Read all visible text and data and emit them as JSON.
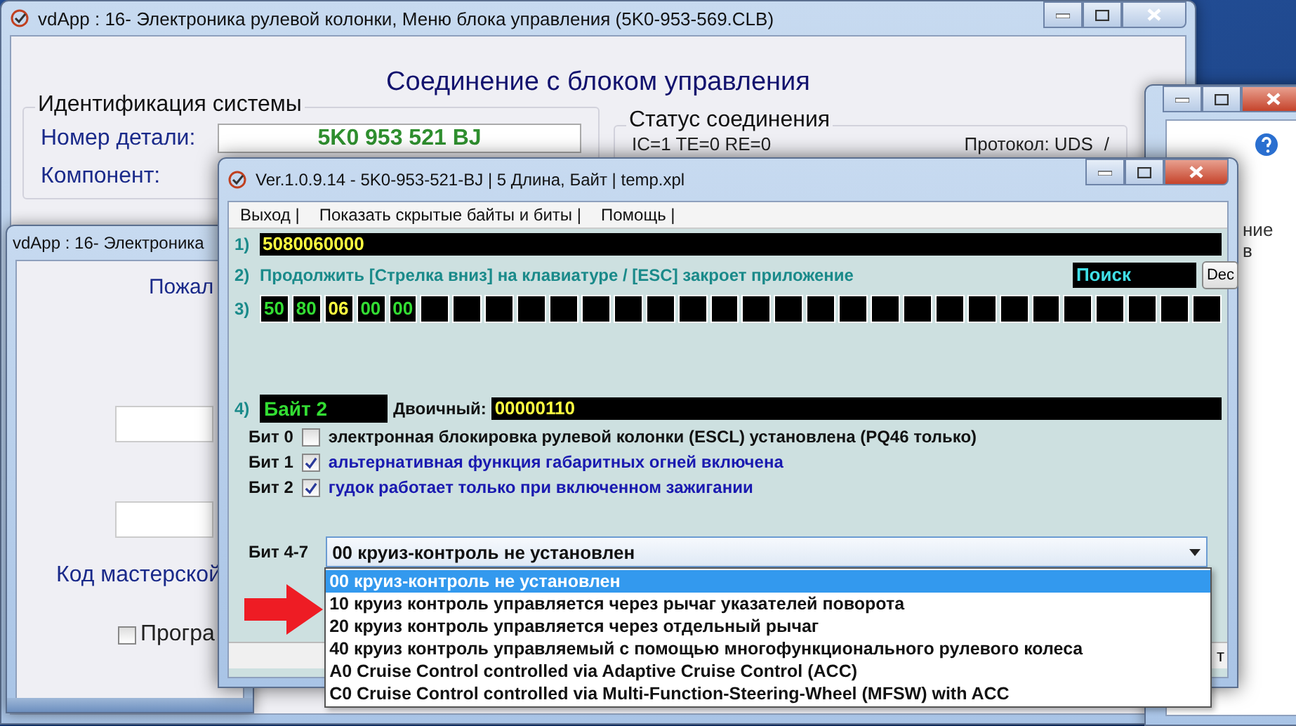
{
  "main_window": {
    "title": "vdApp : 16- Электроника рулевой колонки,  Меню блока управления (5K0-953-569.CLB)",
    "heading": "Соединение с блоком управления",
    "identification": {
      "title": "Идентификация системы",
      "fields": [
        {
          "label": "Номер детали:",
          "value": "5K0 953 521 BJ"
        },
        {
          "label": "Компонент:"
        }
      ]
    },
    "status": {
      "title": "Статус соединения",
      "counters": "IC=1  TE=0   RE=0",
      "protocol": "Протокол: UDS",
      "indicator": "/"
    }
  },
  "side_window": {
    "texts": [
      "ние",
      "в"
    ]
  },
  "back_window": {
    "title": "vdApp : 16- Электроника",
    "prompt": "Пожал",
    "workshop_label": "Код мастерской",
    "checkbox": {
      "label": "Програ",
      "checked": false
    }
  },
  "dialog": {
    "title": "Ver.1.0.9.14 -    5K0-953-521-BJ | 5 Длина, Байт | temp.xpl",
    "menu": [
      "Выход |",
      "Показать скрытые байты и биты |",
      "Помощь |"
    ],
    "row1": {
      "number": "1)",
      "value": "5080060000"
    },
    "row2": {
      "number": "2)",
      "text": "Продолжить [Стрелка вниз] на клавиатуре / [ESC] закроет приложение",
      "search": "Поиск",
      "button": "Dec"
    },
    "row3": {
      "number": "3)",
      "bytes": [
        {
          "value": "50",
          "color": "#33dd33"
        },
        {
          "value": "80",
          "color": "#33dd33"
        },
        {
          "value": "06",
          "color": "#ffff40"
        },
        {
          "value": "00",
          "color": "#33dd33"
        },
        {
          "value": "00",
          "color": "#33dd33"
        }
      ]
    },
    "row4": {
      "number": "4)",
      "byte_label": "Байт 2",
      "binary_label": "Двоичный:",
      "binary_value": "00000110"
    },
    "bits": [
      {
        "label": "Бит 0",
        "text": "электронная блокировка рулевой колонки (ESCL) установлена (PQ46 только)",
        "checked": false
      },
      {
        "label": "Бит 1",
        "text": "альтернативная функция габаритных огней включена",
        "checked": true
      },
      {
        "label": "Бит 2",
        "text": "гудок работает только при включенном зажигании",
        "checked": true
      }
    ],
    "select": {
      "label": "Бит 4-7",
      "value": "00 круиз-контроль не установлен",
      "options": [
        {
          "text": "00 круиз-контроль не установлен",
          "selected": true
        },
        {
          "text": "10 круиз контроль управляется через рычаг указателей поворота",
          "selected": false
        },
        {
          "text": "20 круиз контроль управляется через отдельный рычаг",
          "selected": false
        },
        {
          "text": "40 круиз контроль управляемый с помощью многофункционального рулевого колеса",
          "selected": false
        },
        {
          "text": "A0 Cruise Control controlled via Adaptive Cruise Control (ACC)",
          "selected": false
        },
        {
          "text": "C0 Cruise Control controlled via Multi-Function-Steering-Wheel (MFSW) with ACC",
          "selected": false
        }
      ]
    },
    "status_fragment": "т"
  }
}
